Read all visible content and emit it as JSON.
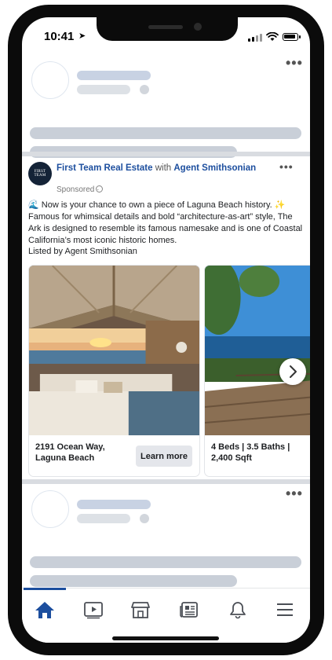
{
  "status_bar": {
    "time": "10:41"
  },
  "post": {
    "page_name": "First Team Real Estate",
    "with_text": "with",
    "agent_name": "Agent Smithsonian",
    "logo_text": "FIRST TEAM",
    "sponsored": "Sponsored ·",
    "body_emoji": "🌊",
    "body": "Now is your chance to own a piece of Laguna Beach history. ✨ Famous for whimsical details and bold “architecture-as-art” style, The Ark is designed to resemble its famous namesake and is one of Coastal California’s most iconic historic homes.",
    "listed_by": "Listed by Agent Smithsonian",
    "more_glyph": "•••",
    "carousel": [
      {
        "line1": "2191 Ocean Way,",
        "line2": "Laguna Beach",
        "cta": "Learn more"
      },
      {
        "line1": "4 Beds | 3.5 Baths |",
        "line2": "2,400 Sqft"
      }
    ]
  },
  "skeleton": {
    "more_glyph": "•••"
  },
  "tab_bar": {
    "tabs": [
      {
        "icon": "home-icon",
        "active": true
      },
      {
        "icon": "video-icon",
        "active": false
      },
      {
        "icon": "marketplace-icon",
        "active": false
      },
      {
        "icon": "news-icon",
        "active": false
      },
      {
        "icon": "bell-icon",
        "active": false
      },
      {
        "icon": "menu-icon",
        "active": false
      }
    ]
  },
  "colors": {
    "accent": "#1c4e9e",
    "skeleton": "#c9cfd8",
    "divider": "#d9dce1"
  }
}
